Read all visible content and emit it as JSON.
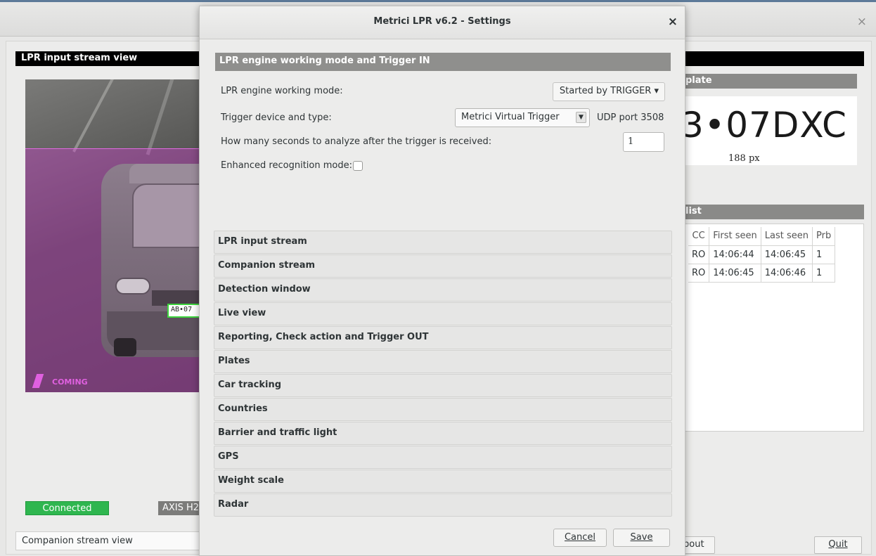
{
  "main_window": {
    "close_icon": "×",
    "lpr_view_title": "LPR input stream view",
    "camera": {
      "plate_overlay_text": "AB•07",
      "direction_label": "COMING",
      "connection_status": "Connected",
      "camera_model": "AXIS H2"
    },
    "companion_view_title": "Companion stream view",
    "plate_panel": {
      "header": "plate",
      "plate_text": "3•07DXC",
      "plate_width": "188 px"
    },
    "list_panel": {
      "header": "list",
      "columns": [
        "CC",
        "First seen",
        "Last seen",
        "Prb"
      ],
      "rows": [
        [
          "RO",
          "14:06:44",
          "14:06:45",
          "1"
        ],
        [
          "RO",
          "14:06:45",
          "14:06:46",
          "1"
        ]
      ]
    },
    "about_label": "bout",
    "quit_label": "Quit"
  },
  "dialog": {
    "title": "Metrici LPR v6.2 - Settings",
    "close_icon": "×",
    "active_section": "LPR engine working mode and Trigger IN",
    "working_mode_label": "LPR engine working mode:",
    "working_mode_value": "Started by TRIGGER ▾",
    "trigger_device_label": "Trigger device and type:",
    "trigger_device_value": "Metrici Virtual Trigger",
    "udp_port": "UDP port 3508",
    "analyze_seconds_label": "How many seconds to analyze after the trigger is received:",
    "analyze_seconds_value": "1",
    "enhanced_mode_label": "Enhanced recognition mode:",
    "enhanced_mode_checked": false,
    "sections": [
      "LPR input stream",
      "Companion stream",
      "Detection window",
      "Live view",
      "Reporting, Check action and Trigger OUT",
      "Plates",
      "Car tracking",
      "Countries",
      "Barrier and traffic light",
      "GPS",
      "Weight scale",
      "Radar"
    ],
    "cancel_label": "Cancel",
    "save_label": "Save"
  },
  "colors": {
    "connected_green": "#2fb64f",
    "detection_overlay": "#d23cd2",
    "section_header_grey": "#8f8f8d",
    "title_bar_accent": "#5d7a99"
  }
}
